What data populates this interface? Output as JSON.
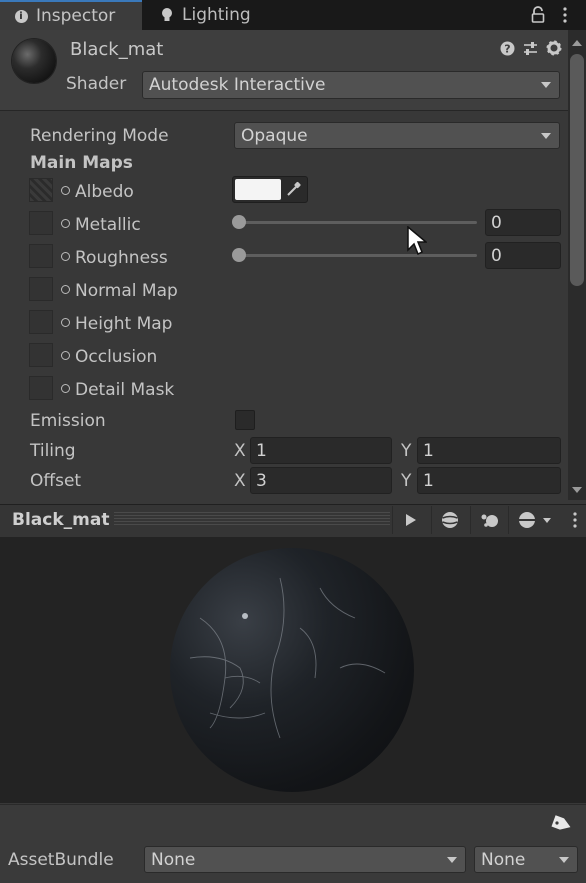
{
  "tabs": [
    {
      "label": "Inspector",
      "icon": "info-icon",
      "active": true
    },
    {
      "label": "Lighting",
      "icon": "lightbulb-icon",
      "active": false
    }
  ],
  "header": {
    "material_name": "Black_mat",
    "shader_label": "Shader",
    "shader_value": "Autodesk Interactive"
  },
  "properties": {
    "rendering_mode_label": "Rendering Mode",
    "rendering_mode_value": "Opaque",
    "main_maps_label": "Main Maps",
    "albedo_label": "Albedo",
    "albedo_color": "#f4f4f4",
    "metallic_label": "Metallic",
    "metallic_value": "0",
    "roughness_label": "Roughness",
    "roughness_value": "0",
    "normal_map_label": "Normal Map",
    "height_map_label": "Height Map",
    "occlusion_label": "Occlusion",
    "detail_mask_label": "Detail Mask",
    "emission_label": "Emission",
    "tiling_label": "Tiling",
    "tiling_x_label": "X",
    "tiling_x": "1",
    "tiling_y_label": "Y",
    "tiling_y": "1",
    "offset_label": "Offset",
    "offset_x_label": "X",
    "offset_x": "3",
    "offset_y_label": "Y",
    "offset_y": "1"
  },
  "preview": {
    "title": "Black_mat"
  },
  "footer": {
    "assetbundle_label": "AssetBundle",
    "assetbundle_value": "None",
    "variant_value": "None"
  },
  "colors": {
    "accent": "#3a79bb",
    "panel": "#383838"
  }
}
